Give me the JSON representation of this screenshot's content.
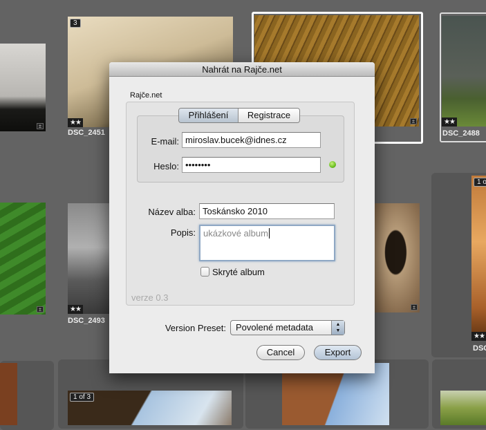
{
  "photos": {
    "top": [
      {
        "name": "DSC_2451",
        "stars": "★★",
        "badge": "3"
      },
      {
        "name": "DSC_2488",
        "stars": "★★"
      }
    ],
    "middle": [
      {
        "name": "DSC_2493",
        "stars": "★★"
      },
      {
        "name": "DSC",
        "stars": "★★",
        "badge": "1 o"
      }
    ],
    "bottom": [
      {
        "badge": "1 of 3"
      }
    ]
  },
  "dialog": {
    "title": "Nahrát na Rajče.net",
    "group_label": "Rajče.net",
    "tabs": [
      "Přihlášení",
      "Registrace"
    ],
    "email_label": "E-mail:",
    "email_value": "miroslav.bucek@idnes.cz",
    "password_label": "Heslo:",
    "password_value": "••••••••",
    "album_label": "Název alba:",
    "album_value": "Toskánsko 2010",
    "desc_label": "Popis:",
    "desc_value": "ukázkové album",
    "hidden_label": "Skryté album",
    "version": "verze 0.3",
    "preset_label": "Version Preset:",
    "preset_value": "Povolené metadata",
    "cancel": "Cancel",
    "export": "Export",
    "status_color": "#6cc020"
  }
}
